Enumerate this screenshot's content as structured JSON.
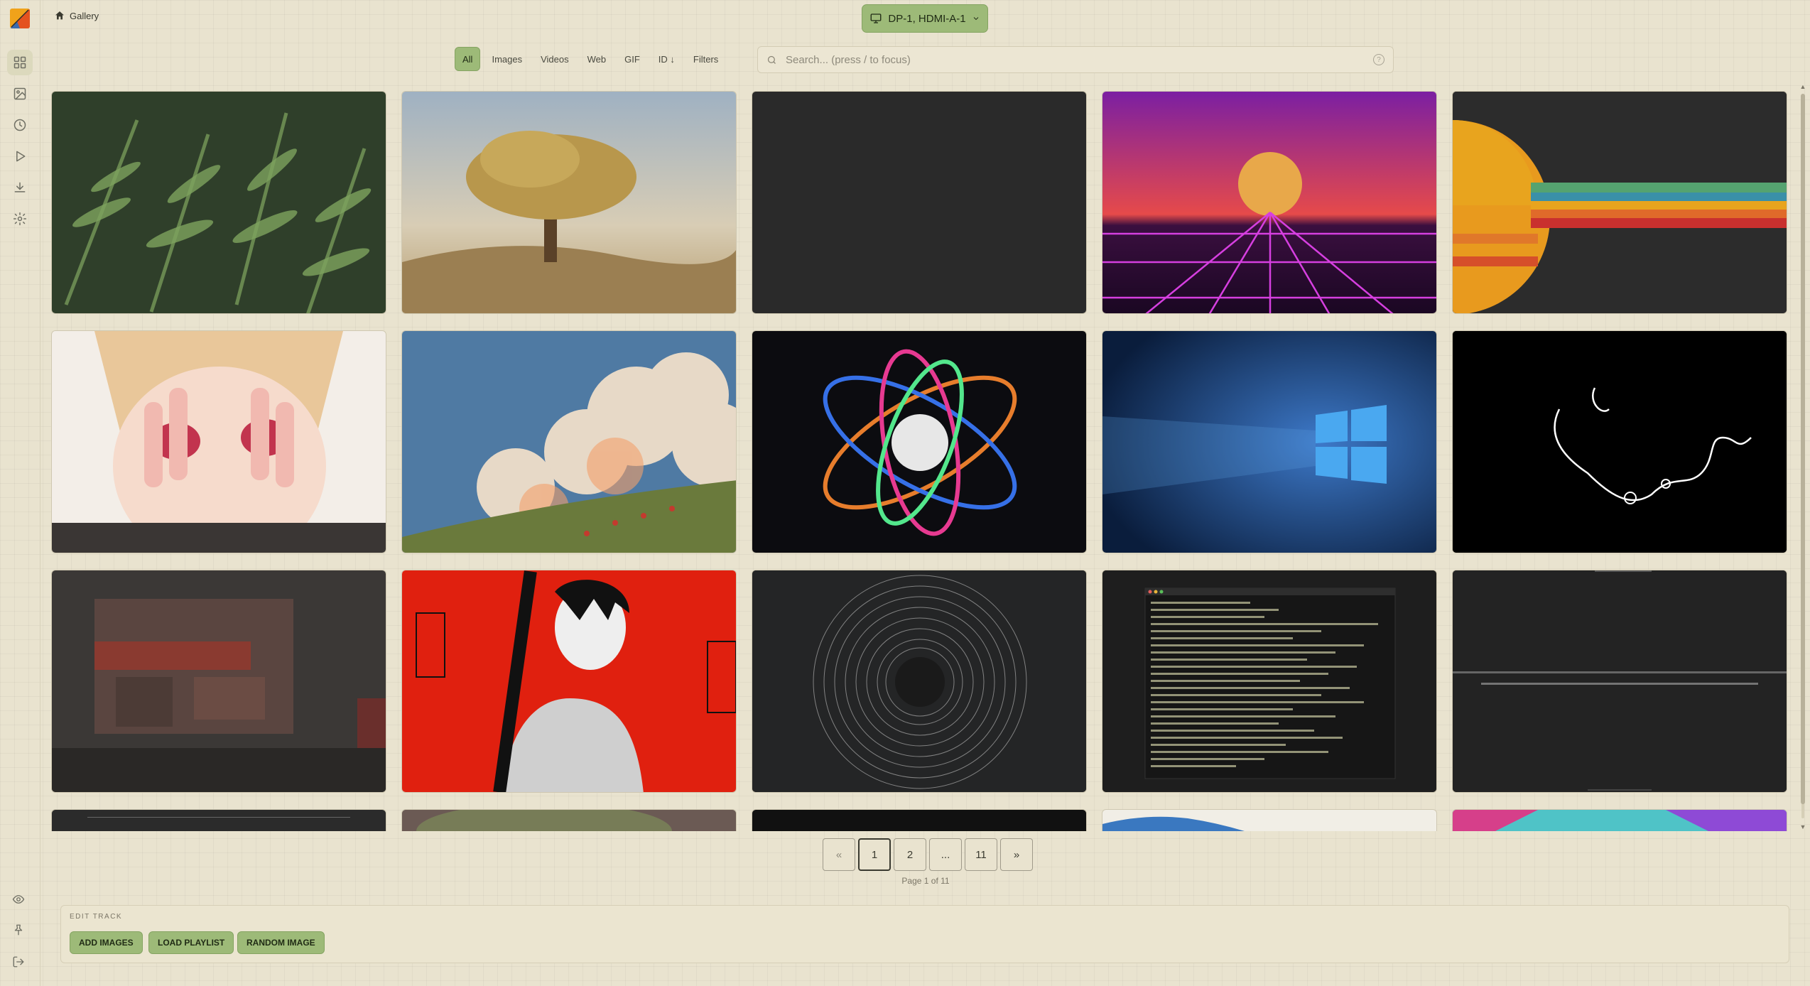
{
  "breadcrumb": {
    "label": "Gallery"
  },
  "monitor": {
    "label": "DP-1, HDMI-A-1"
  },
  "tabs": [
    {
      "label": "All"
    },
    {
      "label": "Images"
    },
    {
      "label": "Videos"
    },
    {
      "label": "Web"
    },
    {
      "label": "GIF"
    },
    {
      "label": "ID ↓"
    },
    {
      "label": "Filters"
    }
  ],
  "search": {
    "placeholder": "Search... (press / to focus)",
    "help_label": "?"
  },
  "pagination": {
    "prev": "«",
    "pages": [
      "1",
      "2",
      "...",
      "11"
    ],
    "next": "»",
    "current": "1",
    "info": "Page 1 of 11"
  },
  "edit_track": {
    "title": "EDIT TRACK",
    "buttons": [
      "ADD IMAGES",
      "LOAD PLAYLIST",
      "RANDOM IMAGE"
    ]
  },
  "thumbnails": [
    {
      "name": "fern-leaves"
    },
    {
      "name": "golden-tree-landscape"
    },
    {
      "name": "blank-dark"
    },
    {
      "name": "synthwave-sunset"
    },
    {
      "name": "retro-stripes-sun"
    },
    {
      "name": "anime-girl-hands"
    },
    {
      "name": "clouds-sky-figures"
    },
    {
      "name": "atom-energy-swirl"
    },
    {
      "name": "windows-logo-blue"
    },
    {
      "name": "white-scribble-black"
    },
    {
      "name": "night-shop-street"
    },
    {
      "name": "red-manga-character"
    },
    {
      "name": "wireframe-ring"
    },
    {
      "name": "terminal-screenshot"
    },
    {
      "name": "text-on-dark"
    }
  ],
  "colors": {
    "accent": "#9dba78",
    "background": "#e9e3cf"
  }
}
